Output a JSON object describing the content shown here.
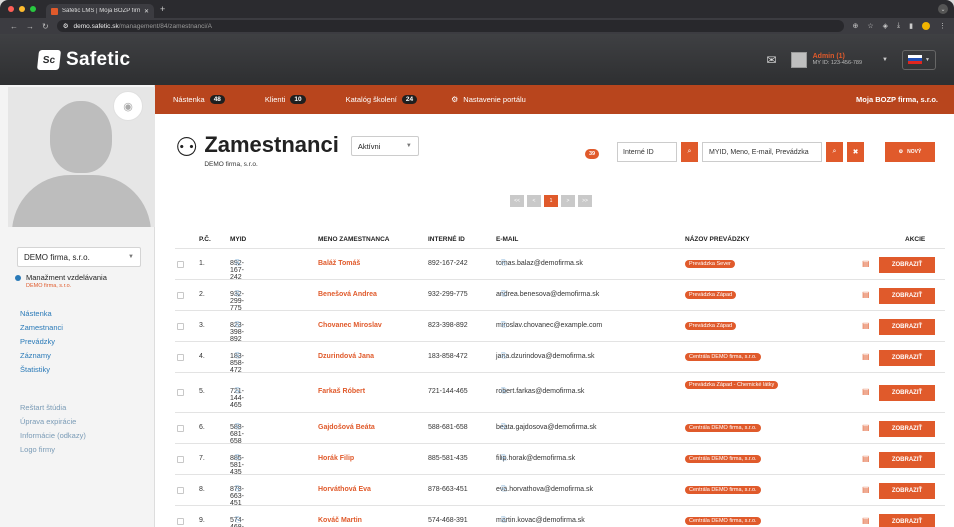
{
  "browser": {
    "tab_title": "Safetic LMS | Moja BOZP firm",
    "url_host": "demo.safetic.sk",
    "url_path": "/management/84/zamestnanci/A"
  },
  "header": {
    "logo_text": "Safetic",
    "logo_mark": "Sc",
    "user_name": "Admin (1)",
    "user_id": "MY ID: 123-456-789"
  },
  "sidebar": {
    "company": "DEMO firma, s.r.o.",
    "section_title": "Manažment vzdelávania",
    "section_sub": "DEMO firma, s.r.o.",
    "links": [
      "Nástenka",
      "Zamestnanci",
      "Prevádzky",
      "Záznamy",
      "Štatistiky"
    ],
    "links2": [
      "Reštart štúdia",
      "Úprava expirácie",
      "Informácie (odkazy)",
      "Logo firmy"
    ]
  },
  "nav": {
    "items": [
      {
        "label": "Nástenka",
        "badge": "48"
      },
      {
        "label": "Klienti",
        "badge": "10"
      },
      {
        "label": "Katalóg školení",
        "badge": "24"
      }
    ],
    "settings": "Nastavenie portálu",
    "right": "Moja BOZP firma, s.r.o."
  },
  "page": {
    "title": "Zamestnanci",
    "subtitle": "DEMO firma, s.r.o.",
    "status": "Aktívni",
    "count": "39",
    "internal_id_placeholder": "Interné ID",
    "search_placeholder": "MYID, Meno, E-mail, Prevádzka",
    "new_button": "NOVÝ",
    "pager": [
      "<<",
      "<",
      "1",
      ">",
      ">>"
    ]
  },
  "table": {
    "headers": [
      "P.Č.",
      "MYID",
      "MENO ZAMESTNANCA",
      "INTERNÉ ID",
      "E-MAIL",
      "NÁZOV PREVÁDZKY",
      "AKCIE"
    ],
    "action_label": "ZOBRAZIŤ",
    "rows": [
      {
        "n": "1.",
        "myid": "892-167-242",
        "name": "Baláž Tomáš",
        "iid": "892-167-242",
        "email": "tomas.balaz@demofirma.sk",
        "tags": [
          "Prevádzka Sever"
        ]
      },
      {
        "n": "2.",
        "myid": "932-299-775",
        "name": "Benešová Andrea",
        "iid": "932-299-775",
        "email": "andrea.benesova@demofirma.sk",
        "tags": [
          "Prevádzka Západ"
        ]
      },
      {
        "n": "3.",
        "myid": "823-398-892",
        "name": "Chovanec Miroslav",
        "iid": "823-398-892",
        "email": "miroslav.chovanec@example.com",
        "tags": [
          "Prevádzka Západ"
        ]
      },
      {
        "n": "4.",
        "myid": "183-858-472",
        "name": "Dzurindová Jana",
        "iid": "183-858-472",
        "email": "jana.dzurindova@demofirma.sk",
        "tags": [
          "Centrála DEMO firma, s.r.o."
        ]
      },
      {
        "n": "5.",
        "myid": "721-144-465",
        "name": "Farkaš Róbert",
        "iid": "721-144-465",
        "email": "robert.farkas@demofirma.sk",
        "tags": [
          "Prevádzka Západ",
          "Prevádzka Západ - Chemické látky"
        ]
      },
      {
        "n": "6.",
        "myid": "588-681-658",
        "name": "Gajdošová Beáta",
        "iid": "588-681-658",
        "email": "beata.gajdosova@demofirma.sk",
        "tags": [
          "Centrála DEMO firma, s.r.o."
        ]
      },
      {
        "n": "7.",
        "myid": "885-581-435",
        "name": "Horák Filip",
        "iid": "885-581-435",
        "email": "filip.horak@demofirma.sk",
        "tags": [
          "Centrála DEMO firma, s.r.o."
        ]
      },
      {
        "n": "8.",
        "myid": "878-663-451",
        "name": "Horváthová Eva",
        "iid": "878-663-451",
        "email": "eva.horvathova@demofirma.sk",
        "tags": [
          "Centrála DEMO firma, s.r.o."
        ]
      },
      {
        "n": "9.",
        "myid": "574-468-391",
        "name": "Kováč Martin",
        "iid": "574-468-391",
        "email": "martin.kovac@demofirma.sk",
        "tags": [
          "Centrála DEMO firma, s.r.o."
        ]
      }
    ]
  },
  "colors": {
    "accent": "#e05a2b",
    "nav": "#b8451d",
    "header": "#3a3b3d",
    "link": "#2a7ab8"
  }
}
